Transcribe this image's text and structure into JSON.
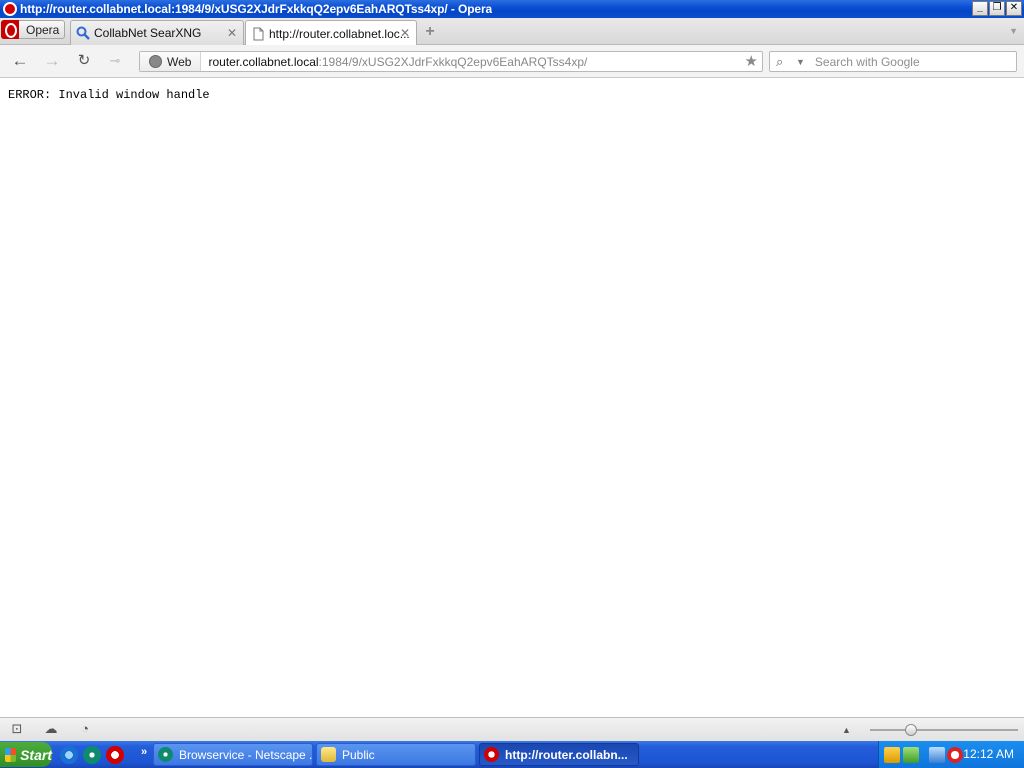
{
  "window": {
    "title": "http://router.collabnet.local:1984/9/xUSG2XJdrFxkkqQ2epv6EahARQTss4xp/ - Opera"
  },
  "menu": {
    "label": "Opera"
  },
  "tabs": [
    {
      "title": "CollabNet SearXNG",
      "active": false
    },
    {
      "title": "http://router.collabnet.loc...",
      "active": true
    }
  ],
  "address": {
    "badge": "Web",
    "host": "router.collabnet.local",
    "path": ":1984/9/xUSG2XJdrFxkkqQ2epv6EahARQTss4xp/"
  },
  "search": {
    "placeholder": "Search with Google"
  },
  "content": {
    "error_text": "ERROR: Invalid window handle"
  },
  "taskbar": {
    "start_label": "Start",
    "items": [
      {
        "label": "Browservice - Netscape ...",
        "active": false
      },
      {
        "label": "Public",
        "active": false
      },
      {
        "label": "http://router.collabn...",
        "active": true
      }
    ],
    "clock": "12:12 AM"
  },
  "colors": {
    "titlebar": "#0a4fd4",
    "taskbar": "#245edb",
    "tray": "#0f74dc",
    "start": "#3a9d2f",
    "opera_red": "#d20000"
  }
}
